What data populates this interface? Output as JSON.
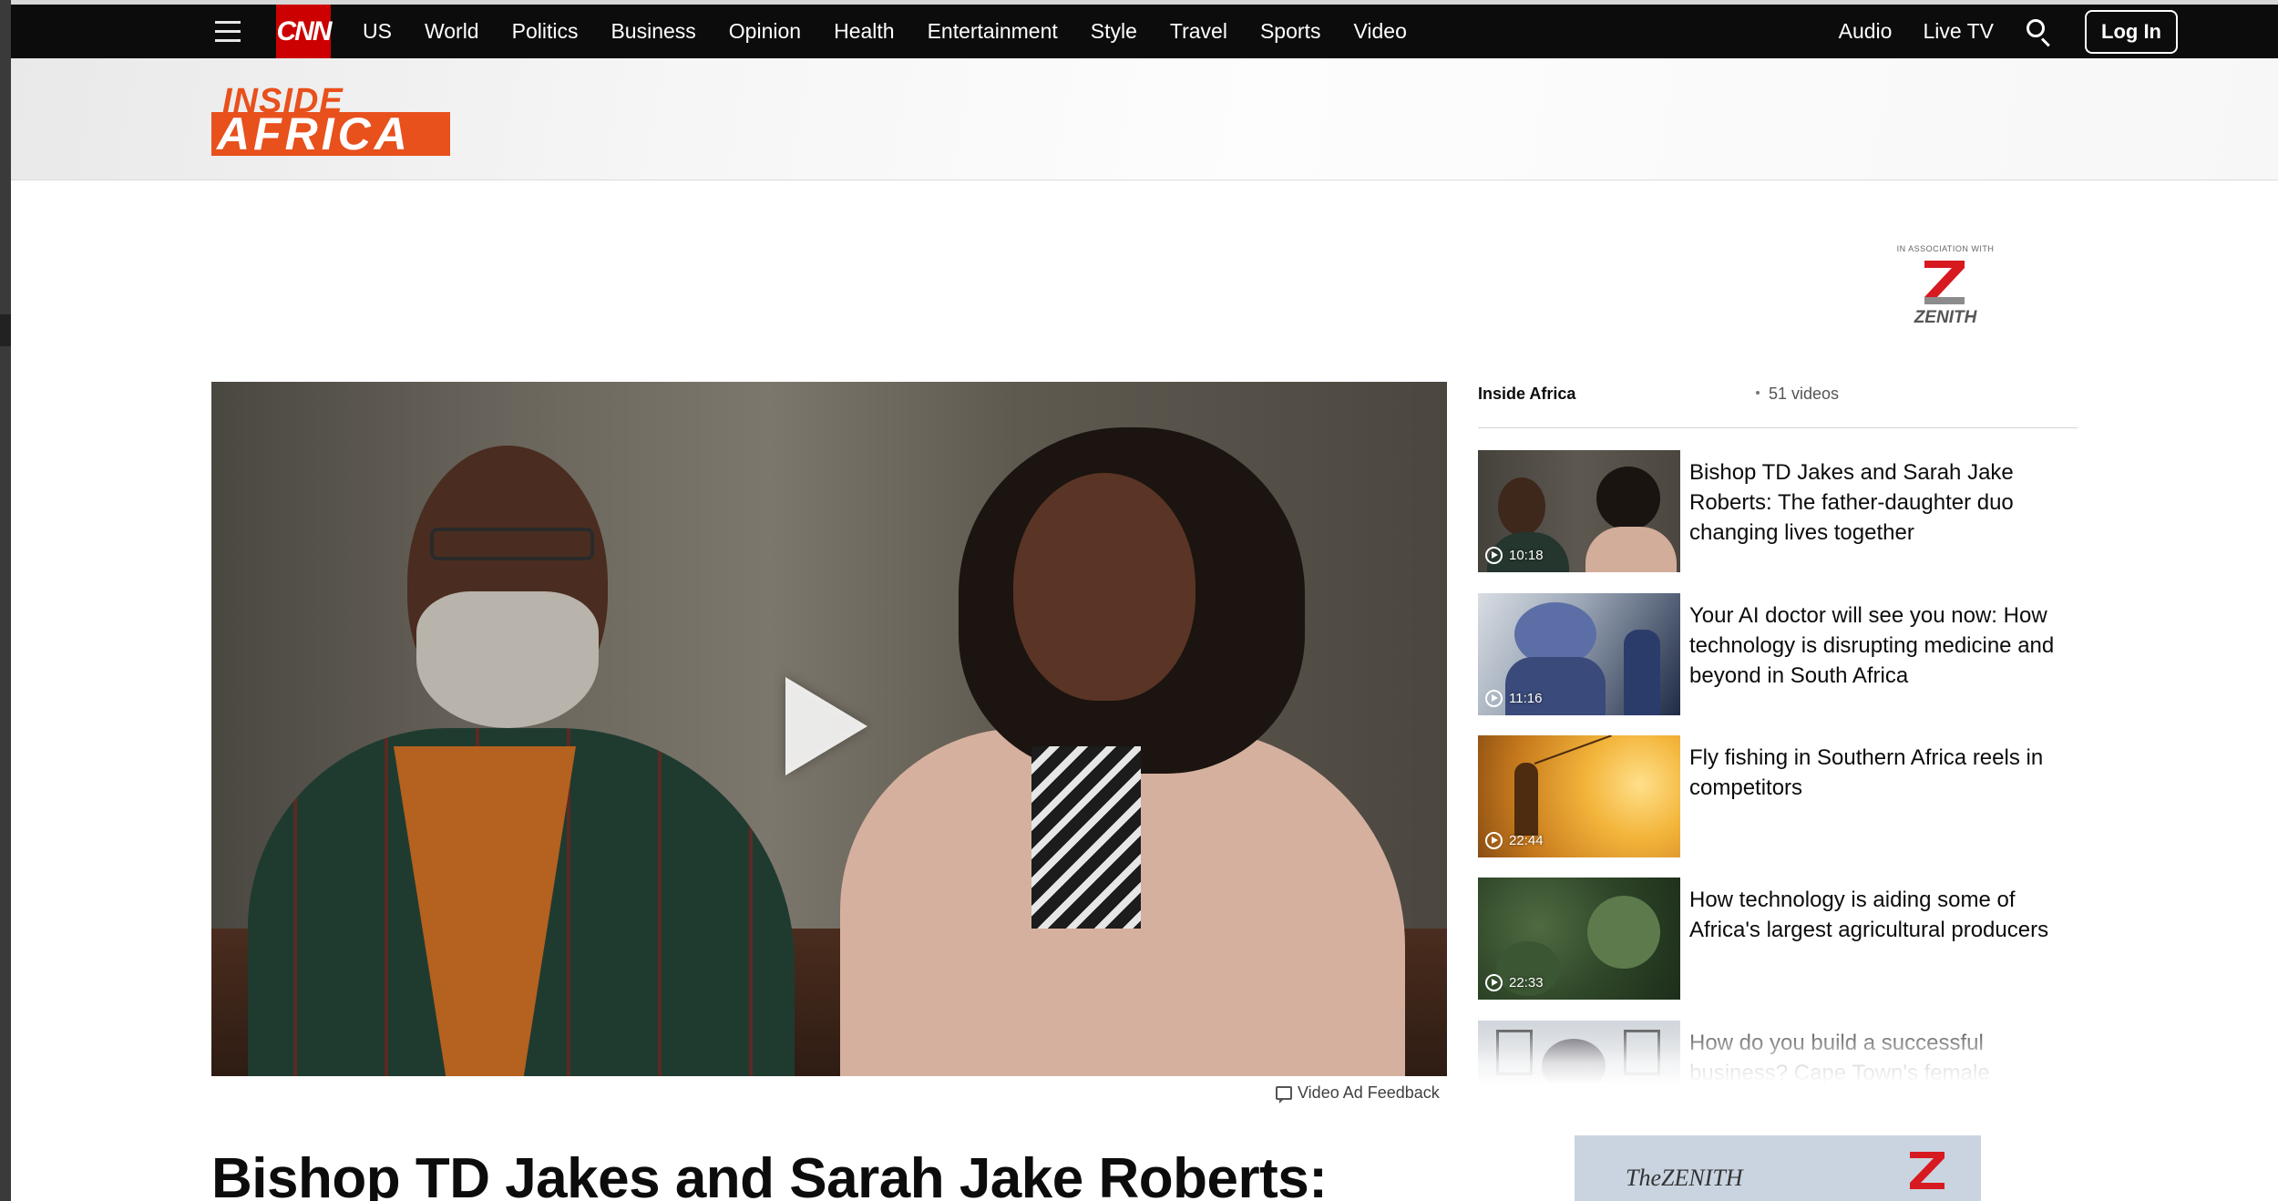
{
  "nav": {
    "logo": "CNN",
    "links": [
      "US",
      "World",
      "Politics",
      "Business",
      "Opinion",
      "Health",
      "Entertainment",
      "Style",
      "Travel",
      "Sports",
      "Video"
    ],
    "right_links": [
      "Audio",
      "Live TV"
    ],
    "login_label": "Log In",
    "icons": [
      "menu-icon",
      "search-icon"
    ]
  },
  "section": {
    "logo_top": "INSIDE",
    "logo_bottom": "AFRICA"
  },
  "sponsor": {
    "label": "IN ASSOCIATION WITH",
    "name": "ZENITH"
  },
  "player": {
    "ad_feedback": "Video Ad Feedback"
  },
  "headline": "Bishop TD Jakes and Sarah Jake Roberts:",
  "playlist": {
    "title": "Inside Africa",
    "count": "51 videos",
    "items": [
      {
        "duration": "10:18",
        "title": "Bishop TD Jakes and Sarah Jake Roberts: The father-daughter duo changing lives together"
      },
      {
        "duration": "11:16",
        "title": "Your AI doctor will see you now: How technology is disrupting medicine and beyond in South Africa"
      },
      {
        "duration": "22:44",
        "title": "Fly fishing in Southern Africa reels in competitors"
      },
      {
        "duration": "22:33",
        "title": "How technology is aiding some of Africa's largest agricultural producers"
      },
      {
        "duration": "",
        "title": "How do you build a successful business? Cape Town's female"
      }
    ]
  },
  "ad": {
    "brand": "TheZENITH",
    "logo_letter": "Z"
  },
  "colors": {
    "cnn_red": "#cc0000",
    "inside_africa_orange": "#e8501c",
    "nav_background": "#0c0c0c"
  }
}
